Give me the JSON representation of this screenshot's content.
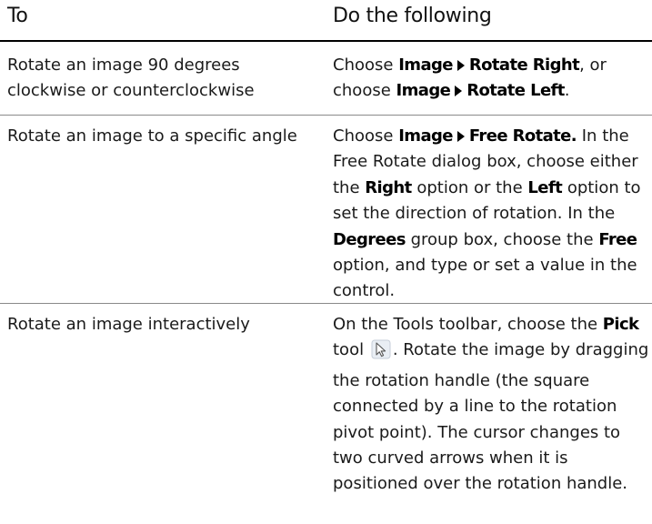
{
  "header": {
    "col_to": "To",
    "col_do": "Do the following"
  },
  "rows": [
    {
      "to": "Rotate an image 90 degrees clockwise or counterclockwise",
      "do": {
        "p1": "Choose ",
        "ui1": "Image",
        "ui2": "Rotate Right",
        "p2": ", or choose ",
        "ui3": "Image",
        "ui4": "Rotate Left",
        "p3": "."
      }
    },
    {
      "to": "Rotate an image to a specific angle",
      "do": {
        "p1": "Choose ",
        "ui1": "Image",
        "ui2": "Free Rotate.",
        "p2": " In the Free Rotate dialog box, choose either the ",
        "ui3": "Right",
        "p3": " option or the ",
        "ui4": "Left",
        "p4": " option to set the direction of rotation. In the ",
        "ui5": "Degrees",
        "p5": " group box, choose the ",
        "ui6": "Free",
        "p6": " option, and type or set a value in the control."
      }
    },
    {
      "to": "Rotate an image interactively",
      "do": {
        "p1": "On the Tools toolbar, choose the ",
        "ui1": "Pick",
        "p2": " tool ",
        "icon": "pick-tool-cursor-icon",
        "p3": ". Rotate the image by dragging the rotation handle (the square connected by a line to the rotation pivot point). The cursor changes to two curved arrows when it is positioned over the rotation handle."
      }
    }
  ]
}
